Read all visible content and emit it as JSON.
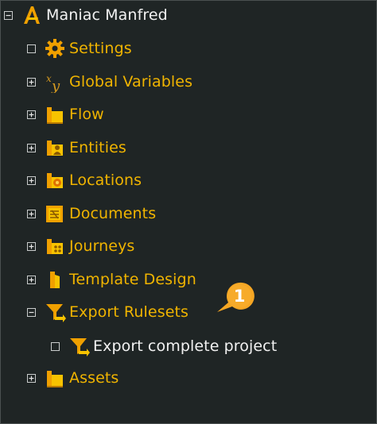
{
  "tree": {
    "root": {
      "label": "Maniac Manfred",
      "expander": "minus",
      "icon": "manfred-logo-icon"
    },
    "items": [
      {
        "label": "Settings",
        "expander": "empty",
        "icon": "gear-icon"
      },
      {
        "label": "Global Variables",
        "expander": "plus",
        "icon": "variables-xy-icon"
      },
      {
        "label": "Flow",
        "expander": "plus",
        "icon": "folder-icon"
      },
      {
        "label": "Entities",
        "expander": "plus",
        "icon": "entities-folder-icon"
      },
      {
        "label": "Locations",
        "expander": "plus",
        "icon": "locations-folder-icon"
      },
      {
        "label": "Documents",
        "expander": "plus",
        "icon": "documents-folder-icon"
      },
      {
        "label": "Journeys",
        "expander": "plus",
        "icon": "journeys-folder-icon"
      },
      {
        "label": "Template Design",
        "expander": "plus",
        "icon": "template-folder-icon"
      },
      {
        "label": "Export Rulesets",
        "expander": "minus",
        "icon": "export-funnel-icon"
      },
      {
        "label": "Export complete project",
        "expander": "empty",
        "icon": "export-funnel-icon",
        "child": true
      },
      {
        "label": "Assets",
        "expander": "plus",
        "icon": "folder-icon"
      }
    ]
  },
  "callout": {
    "number": "1"
  },
  "colors": {
    "background": "#1f2525",
    "label": "#f0b400",
    "child_label": "#f2f2f2",
    "callout": "#f5a623"
  }
}
